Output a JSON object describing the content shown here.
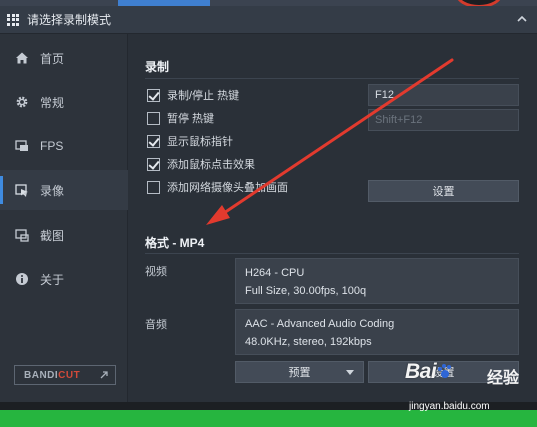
{
  "window": {
    "title": "请选择录制模式"
  },
  "sidebar": {
    "items": [
      {
        "label": "首页",
        "icon": "home-icon"
      },
      {
        "label": "常规",
        "icon": "gear-icon"
      },
      {
        "label": "FPS",
        "icon": "fps-icon"
      },
      {
        "label": "录像",
        "icon": "video-icon",
        "active": true
      },
      {
        "label": "截图",
        "icon": "image-icon"
      },
      {
        "label": "关于",
        "icon": "info-icon"
      }
    ],
    "brand": {
      "text_a": "BANDI",
      "text_b": "CUT"
    }
  },
  "record": {
    "title": "录制",
    "options": [
      {
        "label": "录制/停止 热键",
        "checked": true
      },
      {
        "label": "暂停 热键",
        "checked": false
      },
      {
        "label": "显示鼠标指针",
        "checked": true
      },
      {
        "label": "添加鼠标点击效果",
        "checked": true
      },
      {
        "label": "添加网络摄像头叠加画面",
        "checked": false
      }
    ],
    "hotkey_record": "F12",
    "hotkey_pause": "Shift+F12",
    "settings_label": "设置"
  },
  "format": {
    "title": "格式 - MP4",
    "video_label": "视频",
    "video_codec": "H264 - CPU",
    "video_detail": "Full Size, 30.00fps, 100q",
    "audio_label": "音频",
    "audio_codec": "AAC - Advanced Audio Coding",
    "audio_detail": "48.0KHz, stereo, 192kbps",
    "preset_label": "预置",
    "settings_label": "设置"
  },
  "watermark": {
    "main": "Bai",
    "main_end": "经验",
    "sub": "jingyan.baidu.com"
  },
  "colors": {
    "accent_blue": "#3f8be0",
    "arrow_red": "#e23a2e",
    "brand_red": "#d24a3a",
    "status_green": "#26b53f"
  }
}
